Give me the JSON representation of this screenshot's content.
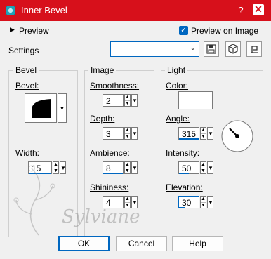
{
  "window": {
    "title": "Inner Bevel",
    "help": "?",
    "close": "✕"
  },
  "preview": {
    "label": "Preview",
    "preview_on_image_label": "Preview on Image"
  },
  "settings": {
    "label": "Settings",
    "preset_value": ""
  },
  "bevel_group": {
    "title": "Bevel",
    "bevel_label": "Bevel:",
    "width_label": "Width:",
    "width_value": "15"
  },
  "image_group": {
    "title": "Image",
    "smoothness_label": "Smoothness:",
    "smoothness_value": "2",
    "depth_label": "Depth:",
    "depth_value": "3",
    "ambience_label": "Ambience:",
    "ambience_value": "8",
    "shininess_label": "Shininess:",
    "shininess_value": "4"
  },
  "light_group": {
    "title": "Light",
    "color_label": "Color:",
    "color_value": "#ffffff",
    "angle_label": "Angle:",
    "angle_value": "315",
    "intensity_label": "Intensity:",
    "intensity_value": "50",
    "elevation_label": "Elevation:",
    "elevation_value": "30"
  },
  "buttons": {
    "ok": "OK",
    "cancel": "Cancel",
    "help": "Help"
  },
  "watermark": "Sylviane",
  "colors": {
    "titlebar": "#d7101b",
    "accent": "#0067c0",
    "dialog_bg": "#f0f0f0"
  }
}
